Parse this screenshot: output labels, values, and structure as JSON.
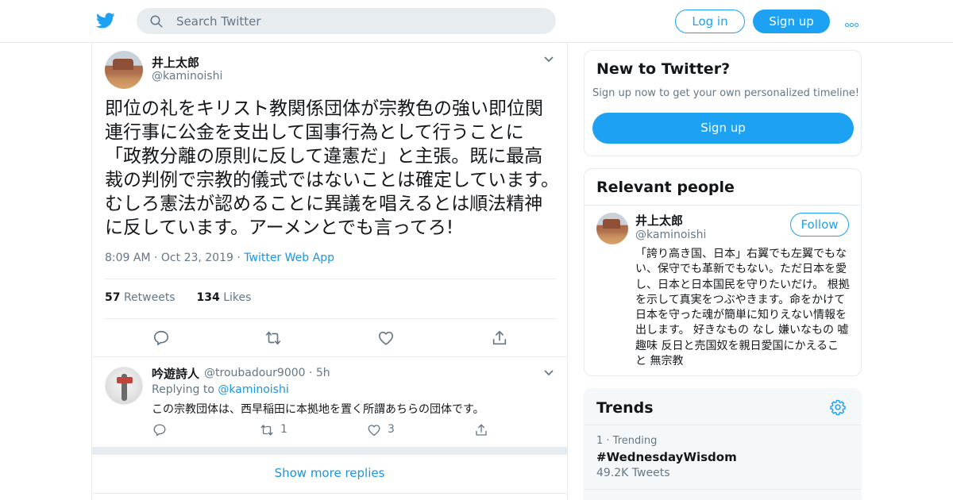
{
  "header": {
    "search_placeholder": "Search Twitter",
    "login_label": "Log in",
    "signup_label": "Sign up"
  },
  "tweet": {
    "author_name": "井上太郎",
    "author_handle": "@kaminoishi",
    "text": "即位の礼をキリスト教関係団体が宗教色の強い即位関連行事に公金を支出して国事行為として行うことに「政教分離の原則に反して違憲だ」と主張。既に最高裁の判例で宗教的儀式ではないことは確定しています。むしろ憲法が認めることに異議を唱えるとは順法精神に反しています。アーメンとでも言ってろ!",
    "time": "8:09 AM",
    "date": "Oct 23, 2019",
    "source": "Twitter Web App",
    "retweets_count": "57",
    "retweets_label": "Retweets",
    "likes_count": "134",
    "likes_label": "Likes"
  },
  "reply": {
    "name": "吟遊詩人",
    "handle_time": "@troubadour9000 · 5h",
    "replying_prefix": "Replying to",
    "replying_to": "@kaminoishi",
    "text": "この宗教団体は、西早稲田に本拠地を置く所謂あちらの団体です。",
    "retweets": "1",
    "likes": "3"
  },
  "show_more_label": "Show more replies",
  "new_to_twitter": {
    "title": "New to Twitter?",
    "subtitle": "Sign up now to get your own personalized timeline!",
    "button": "Sign up"
  },
  "relevant_people": {
    "title": "Relevant people",
    "name": "井上太郎",
    "handle": "@kaminoishi",
    "follow_label": "Follow",
    "bio": "「誇り高き国、日本」右翼でも左翼でもない、保守でも革新でもない。ただ日本を愛し、日本と日本国民を守りたいだけ。 根拠を示して真実をつぶやきます。命をかけて日本を守った魂が簡単に知りえない情報を出します。 好きなもの なし 嫌いなもの 嘘 趣味 反日と売国奴を親日愛国にかえること 無宗教"
  },
  "trends": {
    "title": "Trends",
    "items": [
      {
        "meta": "1 · Trending",
        "name": "#WednesdayWisdom",
        "count": "49.2K Tweets"
      }
    ]
  },
  "colors": {
    "accent": "#1da1f2",
    "link": "#1b95e0",
    "secondary_text": "#657786",
    "border": "#e6ecf0"
  },
  "icons": [
    "twitter-bird-icon",
    "search-icon",
    "more-dots-icon",
    "chevron-down-icon",
    "reply-icon",
    "retweet-icon",
    "like-icon",
    "share-icon",
    "gear-icon"
  ]
}
